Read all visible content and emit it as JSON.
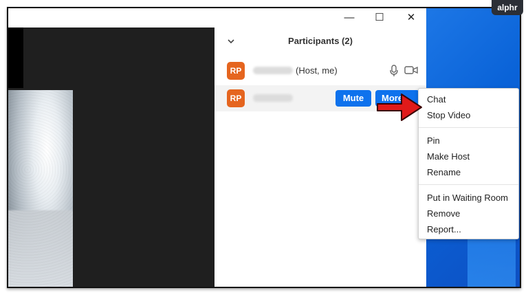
{
  "watermark": {
    "brand": "alphr"
  },
  "window": {
    "controls": {
      "minimize": "—",
      "maximize": "☐",
      "close": "✕"
    }
  },
  "participants": {
    "title": "Participants (2)",
    "rows": [
      {
        "initials": "RP",
        "suffix": "(Host, me)"
      },
      {
        "initials": "RP",
        "mute_label": "Mute",
        "more_label": "More ›"
      }
    ]
  },
  "context_menu": {
    "items": [
      "Chat",
      "Stop Video",
      "Pin",
      "Make Host",
      "Rename",
      "Put in Waiting Room",
      "Remove",
      "Report..."
    ]
  },
  "colors": {
    "accent": "#0e72ed",
    "avatar": "#e5651f",
    "arrow": "#e01a1a",
    "desktop": "#0a63d8"
  },
  "icons": [
    "chevron-down-icon",
    "microphone-icon",
    "video-camera-icon",
    "pointer-arrow-icon"
  ]
}
